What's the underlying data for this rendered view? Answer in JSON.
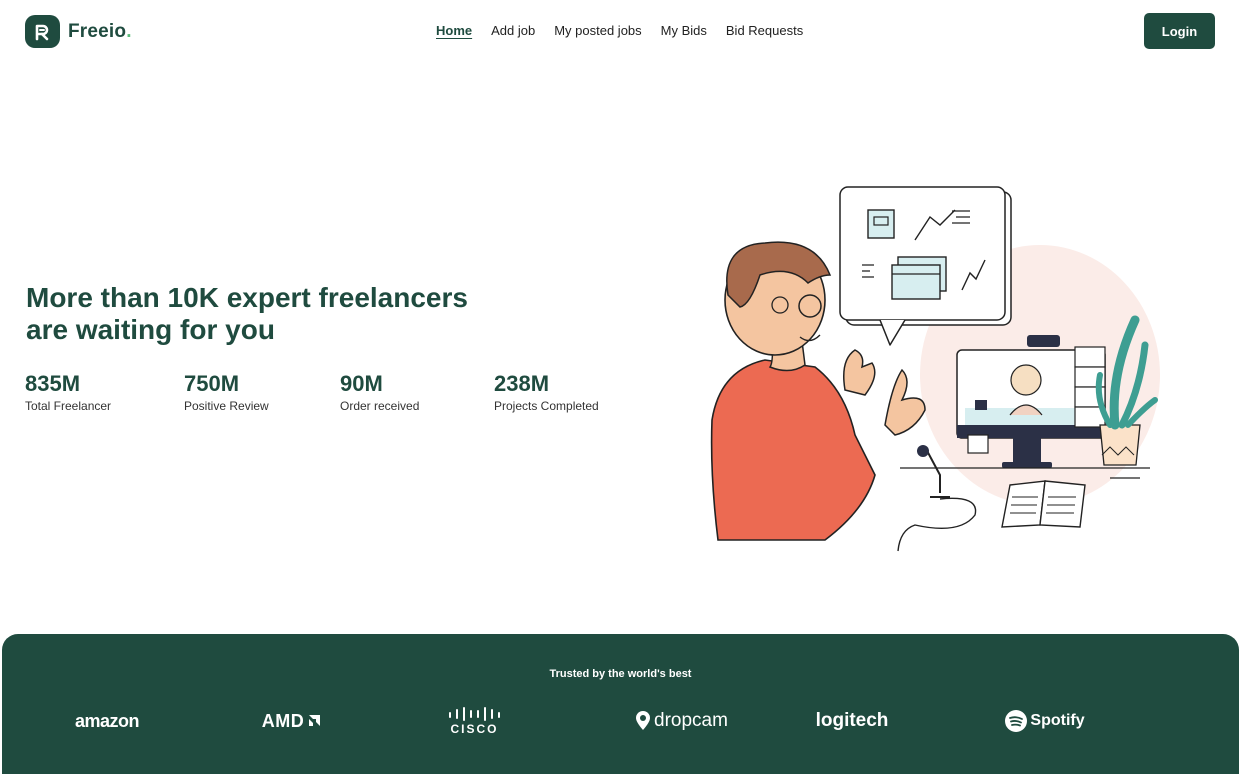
{
  "header": {
    "logo_text": "Freeio",
    "logo_dot": ".",
    "nav": [
      {
        "label": "Home",
        "active": true
      },
      {
        "label": "Add job",
        "active": false
      },
      {
        "label": "My posted jobs",
        "active": false
      },
      {
        "label": "My Bids",
        "active": false
      },
      {
        "label": "Bid Requests",
        "active": false
      }
    ],
    "login_label": "Login"
  },
  "hero": {
    "title": "More than 10K expert freelancers are waiting for you",
    "stats": [
      {
        "value": "835M",
        "label": "Total Freelancer"
      },
      {
        "value": "750M",
        "label": "Positive Review"
      },
      {
        "value": "90M",
        "label": "Order received"
      },
      {
        "value": "238M",
        "label": "Projects Completed"
      }
    ]
  },
  "trusted": {
    "heading": "Trusted by the world's best",
    "brands": [
      "amazon",
      "AMD",
      "CISCO",
      "dropcam",
      "logitech",
      "Spotify"
    ]
  },
  "colors": {
    "brand_green": "#1f4b3f",
    "accent_green": "#5bbb7b",
    "shirt_orange": "#ec6a52",
    "blob_pink": "#fbece8"
  },
  "icons": [
    "logo-mark-icon",
    "chevron-up-icon"
  ]
}
